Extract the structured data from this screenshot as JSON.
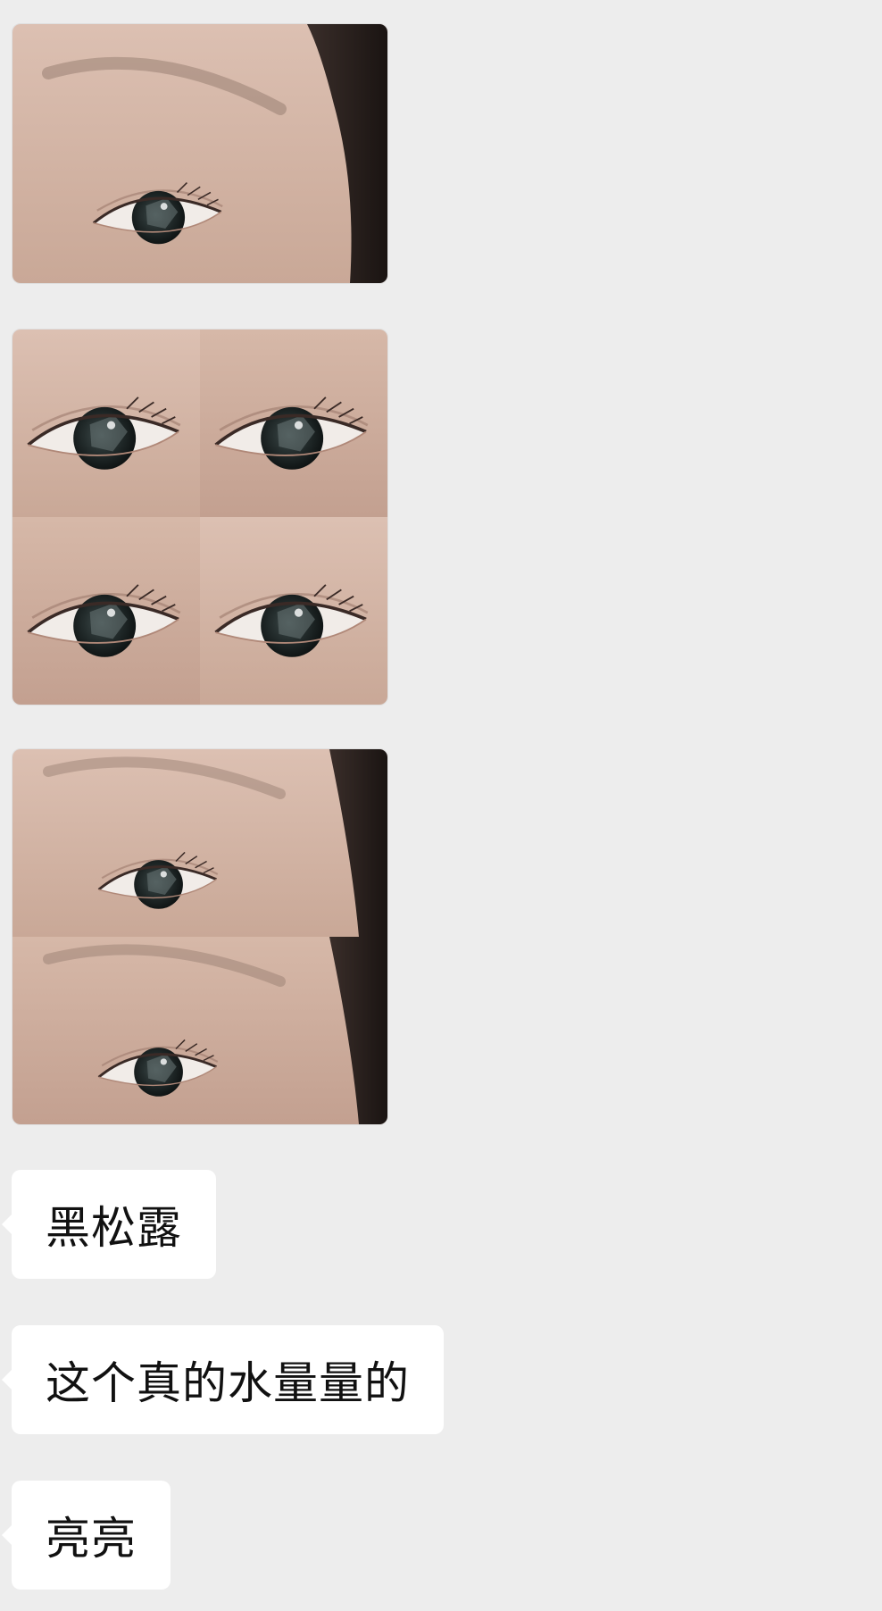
{
  "chat": {
    "messages": [
      {
        "type": "image",
        "description_icon": "eye-single-photo"
      },
      {
        "type": "image",
        "description_icon": "eye-grid-photo"
      },
      {
        "type": "image",
        "description_icon": "eye-stack-photo"
      },
      {
        "type": "text",
        "text": "黑松露"
      },
      {
        "type": "text",
        "text": "这个真的水量量的"
      },
      {
        "type": "text",
        "text": "亮亮"
      }
    ]
  },
  "colors": {
    "background": "#ededed",
    "bubble": "#ffffff",
    "text": "#111111"
  }
}
